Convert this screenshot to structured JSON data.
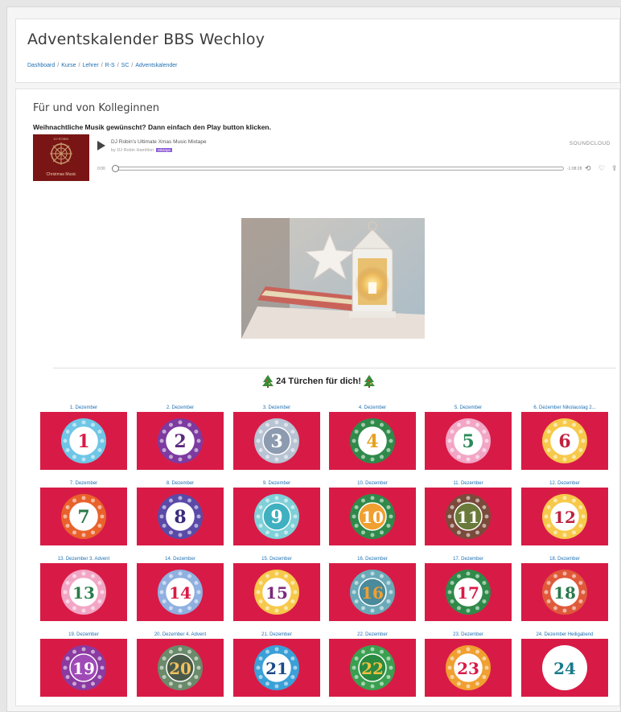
{
  "page": {
    "title": "Adventskalender BBS Wechloy",
    "breadcrumb": [
      "Dashboard",
      "Kurse",
      "Lehrer",
      "R-S",
      "SC",
      "Adventskalender"
    ]
  },
  "section": {
    "title": "Für und von Kolleginnen",
    "intro": "Weihnachtliche Musik gewünscht? Dann einfach den Play button klicken."
  },
  "player": {
    "cover_top": "DJ ROBIN",
    "cover_text": "Christmas Music",
    "track_title": "DJ Robin's Ultimate Xmas Music Mixtape",
    "artist": "by DJ Robin Hamilton",
    "badge": "Mixtape",
    "brand": "SOUNDCLOUD",
    "time_elapsed": "0:00",
    "time_total": "-1:08:28",
    "progress": 0
  },
  "calendar": {
    "heading": "24 Türchen für dich!",
    "doors": [
      {
        "label": "1. Dezember",
        "number": "1",
        "ring": "#6fc6e6",
        "inner": "#ffffff",
        "num_color": "#d81b46"
      },
      {
        "label": "2. Dezember",
        "number": "2",
        "ring": "#7d3aa0",
        "inner": "#ffffff",
        "num_color": "#5b2a7c"
      },
      {
        "label": "3. Dezember",
        "number": "3",
        "ring": "#b8c3d3",
        "inner": "#8c9bb0",
        "num_color": "#ffffff"
      },
      {
        "label": "4. Dezember",
        "number": "4",
        "ring": "#2f8a4a",
        "inner": "#ffffff",
        "num_color": "#e6a020"
      },
      {
        "label": "5. Dezember",
        "number": "5",
        "ring": "#f2a6c5",
        "inner": "#ffffff",
        "num_color": "#2a8a5a"
      },
      {
        "label": "6. Dezember Nikolaustag 2...",
        "number": "6",
        "ring": "#f7c94a",
        "inner": "#ffffff",
        "num_color": "#c0213f"
      },
      {
        "label": "7. Dezember",
        "number": "7",
        "ring": "#e9622b",
        "inner": "#ffffff",
        "num_color": "#2a7a4a"
      },
      {
        "label": "8. Dezember",
        "number": "8",
        "ring": "#5a4aa8",
        "inner": "#ffffff",
        "num_color": "#3a2a7a"
      },
      {
        "label": "9. Dezember",
        "number": "9",
        "ring": "#7fd0d8",
        "inner": "#3fb0c0",
        "num_color": "#ffffff"
      },
      {
        "label": "10. Dezember",
        "number": "10",
        "ring": "#2f8a4a",
        "inner": "#f0a030",
        "num_color": "#ffffff"
      },
      {
        "label": "11. Dezember",
        "number": "11",
        "ring": "#7a4a3a",
        "inner": "#6a7a3a",
        "num_color": "#ffffff"
      },
      {
        "label": "12. Dezember",
        "number": "12",
        "ring": "#f7c94a",
        "inner": "#ffffff",
        "num_color": "#c0213f"
      },
      {
        "label": "13. Dezember 3. Advent",
        "number": "13",
        "ring": "#f2a6c5",
        "inner": "#ffffff",
        "num_color": "#2a7a4a"
      },
      {
        "label": "14. Dezember",
        "number": "14",
        "ring": "#8fb0e0",
        "inner": "#ffffff",
        "num_color": "#d81b46"
      },
      {
        "label": "15. Dezember",
        "number": "15",
        "ring": "#f7c94a",
        "inner": "#ffffff",
        "num_color": "#7a2a7a"
      },
      {
        "label": "16. Dezember",
        "number": "16",
        "ring": "#6aaab8",
        "inner": "#4a8a9a",
        "num_color": "#f0a030"
      },
      {
        "label": "17. Dezember",
        "number": "17",
        "ring": "#2f8a4a",
        "inner": "#ffffff",
        "num_color": "#d81b46"
      },
      {
        "label": "18. Dezember",
        "number": "18",
        "ring": "#e05a3a",
        "inner": "#ffffff",
        "num_color": "#2a7a4a"
      },
      {
        "label": "19. Dezember",
        "number": "19",
        "ring": "#8a3aa0",
        "inner": "#a04ab8",
        "num_color": "#ffffff"
      },
      {
        "label": "20. Dezember 4. Advent",
        "number": "20",
        "ring": "#6a8a6a",
        "inner": "#4a5a4a",
        "num_color": "#f0c060"
      },
      {
        "label": "21. Dezember",
        "number": "21",
        "ring": "#3aa0d8",
        "inner": "#ffffff",
        "num_color": "#1a4a8a"
      },
      {
        "label": "22. Dezember",
        "number": "22",
        "ring": "#3aa050",
        "inner": "#2a8a40",
        "num_color": "#f0c040"
      },
      {
        "label": "23. Dezember",
        "number": "23",
        "ring": "#f0a030",
        "inner": "#ffffff",
        "num_color": "#d81b46"
      },
      {
        "label": "24. Dezember Heiligabend",
        "number": "24",
        "ring": "#ffffff",
        "inner": "#ffffff",
        "num_color": "#1a7a8a"
      }
    ]
  }
}
